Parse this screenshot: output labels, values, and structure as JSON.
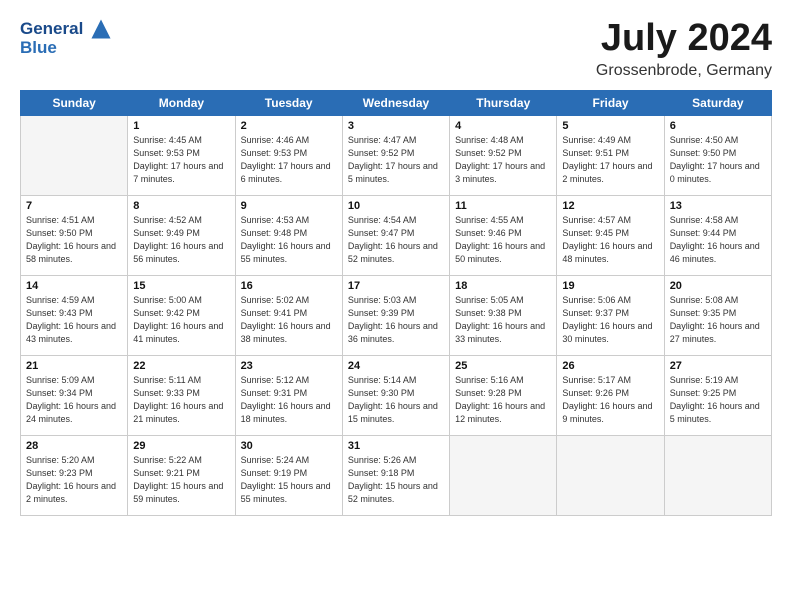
{
  "logo": {
    "line1": "General",
    "line2": "Blue"
  },
  "title": "July 2024",
  "location": "Grossenbrode, Germany",
  "days_header": [
    "Sunday",
    "Monday",
    "Tuesday",
    "Wednesday",
    "Thursday",
    "Friday",
    "Saturday"
  ],
  "weeks": [
    [
      {
        "num": "",
        "empty": true
      },
      {
        "num": "1",
        "rise": "4:45 AM",
        "set": "9:53 PM",
        "daylight": "17 hours and 7 minutes."
      },
      {
        "num": "2",
        "rise": "4:46 AM",
        "set": "9:53 PM",
        "daylight": "17 hours and 6 minutes."
      },
      {
        "num": "3",
        "rise": "4:47 AM",
        "set": "9:52 PM",
        "daylight": "17 hours and 5 minutes."
      },
      {
        "num": "4",
        "rise": "4:48 AM",
        "set": "9:52 PM",
        "daylight": "17 hours and 3 minutes."
      },
      {
        "num": "5",
        "rise": "4:49 AM",
        "set": "9:51 PM",
        "daylight": "17 hours and 2 minutes."
      },
      {
        "num": "6",
        "rise": "4:50 AM",
        "set": "9:50 PM",
        "daylight": "17 hours and 0 minutes."
      }
    ],
    [
      {
        "num": "7",
        "rise": "4:51 AM",
        "set": "9:50 PM",
        "daylight": "16 hours and 58 minutes."
      },
      {
        "num": "8",
        "rise": "4:52 AM",
        "set": "9:49 PM",
        "daylight": "16 hours and 56 minutes."
      },
      {
        "num": "9",
        "rise": "4:53 AM",
        "set": "9:48 PM",
        "daylight": "16 hours and 55 minutes."
      },
      {
        "num": "10",
        "rise": "4:54 AM",
        "set": "9:47 PM",
        "daylight": "16 hours and 52 minutes."
      },
      {
        "num": "11",
        "rise": "4:55 AM",
        "set": "9:46 PM",
        "daylight": "16 hours and 50 minutes."
      },
      {
        "num": "12",
        "rise": "4:57 AM",
        "set": "9:45 PM",
        "daylight": "16 hours and 48 minutes."
      },
      {
        "num": "13",
        "rise": "4:58 AM",
        "set": "9:44 PM",
        "daylight": "16 hours and 46 minutes."
      }
    ],
    [
      {
        "num": "14",
        "rise": "4:59 AM",
        "set": "9:43 PM",
        "daylight": "16 hours and 43 minutes."
      },
      {
        "num": "15",
        "rise": "5:00 AM",
        "set": "9:42 PM",
        "daylight": "16 hours and 41 minutes."
      },
      {
        "num": "16",
        "rise": "5:02 AM",
        "set": "9:41 PM",
        "daylight": "16 hours and 38 minutes."
      },
      {
        "num": "17",
        "rise": "5:03 AM",
        "set": "9:39 PM",
        "daylight": "16 hours and 36 minutes."
      },
      {
        "num": "18",
        "rise": "5:05 AM",
        "set": "9:38 PM",
        "daylight": "16 hours and 33 minutes."
      },
      {
        "num": "19",
        "rise": "5:06 AM",
        "set": "9:37 PM",
        "daylight": "16 hours and 30 minutes."
      },
      {
        "num": "20",
        "rise": "5:08 AM",
        "set": "9:35 PM",
        "daylight": "16 hours and 27 minutes."
      }
    ],
    [
      {
        "num": "21",
        "rise": "5:09 AM",
        "set": "9:34 PM",
        "daylight": "16 hours and 24 minutes."
      },
      {
        "num": "22",
        "rise": "5:11 AM",
        "set": "9:33 PM",
        "daylight": "16 hours and 21 minutes."
      },
      {
        "num": "23",
        "rise": "5:12 AM",
        "set": "9:31 PM",
        "daylight": "16 hours and 18 minutes."
      },
      {
        "num": "24",
        "rise": "5:14 AM",
        "set": "9:30 PM",
        "daylight": "16 hours and 15 minutes."
      },
      {
        "num": "25",
        "rise": "5:16 AM",
        "set": "9:28 PM",
        "daylight": "16 hours and 12 minutes."
      },
      {
        "num": "26",
        "rise": "5:17 AM",
        "set": "9:26 PM",
        "daylight": "16 hours and 9 minutes."
      },
      {
        "num": "27",
        "rise": "5:19 AM",
        "set": "9:25 PM",
        "daylight": "16 hours and 5 minutes."
      }
    ],
    [
      {
        "num": "28",
        "rise": "5:20 AM",
        "set": "9:23 PM",
        "daylight": "16 hours and 2 minutes."
      },
      {
        "num": "29",
        "rise": "5:22 AM",
        "set": "9:21 PM",
        "daylight": "15 hours and 59 minutes."
      },
      {
        "num": "30",
        "rise": "5:24 AM",
        "set": "9:19 PM",
        "daylight": "15 hours and 55 minutes."
      },
      {
        "num": "31",
        "rise": "5:26 AM",
        "set": "9:18 PM",
        "daylight": "15 hours and 52 minutes."
      },
      {
        "num": "",
        "empty": true
      },
      {
        "num": "",
        "empty": true
      },
      {
        "num": "",
        "empty": true
      }
    ]
  ]
}
